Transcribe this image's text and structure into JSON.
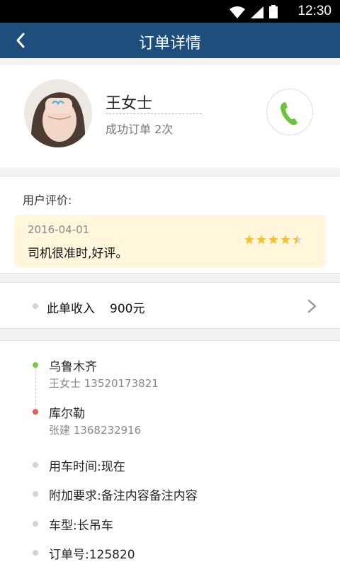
{
  "status_bar": {
    "time": "12:30"
  },
  "header": {
    "title": "订单详情"
  },
  "profile": {
    "name": "王女士",
    "orders": "成功订单 2次"
  },
  "review": {
    "title": "用户评价:",
    "date": "2016-04-01",
    "text": "司机很准时,好评。",
    "rating": 4.5,
    "max_rating": 5
  },
  "income": {
    "label": "此单收入",
    "value": "900元"
  },
  "route": {
    "from": {
      "place": "乌鲁木齐",
      "contact": "王女士 13520173821"
    },
    "to": {
      "place": "库尔勒",
      "contact": "张建 1368232916"
    }
  },
  "details": [
    {
      "text": "用车时间:现在"
    },
    {
      "text": "附加要求:备注内容备注内容"
    },
    {
      "text": "车型:长吊车"
    },
    {
      "text": "订单号:125820"
    }
  ],
  "colors": {
    "header": "#1d4e7c",
    "accent_green": "#7ac943",
    "dest_red": "#e06060",
    "star": "#f2c22e"
  }
}
